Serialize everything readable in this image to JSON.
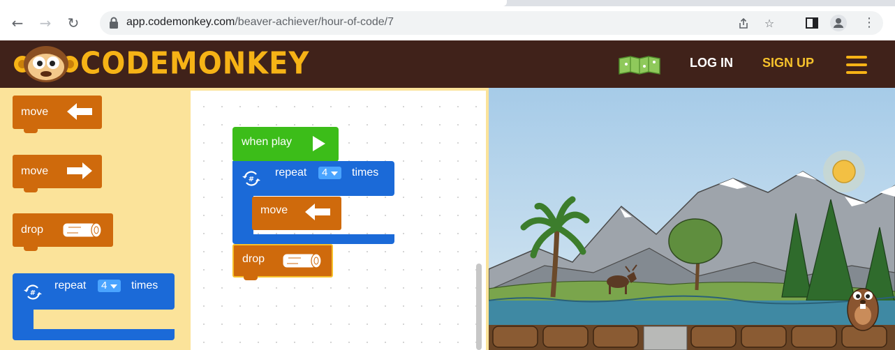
{
  "browser": {
    "url_host": "app.codemonkey.com",
    "url_path": "/beaver-achiever/hour-of-code/7"
  },
  "header": {
    "logo_text": "CODEMONKEY",
    "login_label": "LOG IN",
    "signup_label": "SIGN UP",
    "colors": {
      "background": "#40221a",
      "logo": "#f6b316",
      "signup": "#f6c22c"
    }
  },
  "toolbox": {
    "blocks": [
      {
        "label": "move",
        "icon": "arrow-left-icon"
      },
      {
        "label": "move",
        "icon": "arrow-right-icon"
      },
      {
        "label": "drop",
        "icon": "log-icon"
      },
      {
        "label": "repeat",
        "count": "4",
        "suffix": "times",
        "icon": "repeat-icon"
      }
    ]
  },
  "workspace": {
    "when_play": {
      "label": "when play",
      "icon": "play-icon"
    },
    "repeat": {
      "label": "repeat",
      "count": "4",
      "suffix": "times"
    },
    "inner_move": {
      "label": "move",
      "icon": "arrow-left-icon"
    },
    "drop": {
      "label": "drop",
      "icon": "log-icon"
    }
  },
  "colors": {
    "move_block": "#cf6a0c",
    "repeat_block": "#1b6ad8",
    "play_block": "#3cbd19",
    "toolbox_bg": "#fbe39a"
  }
}
